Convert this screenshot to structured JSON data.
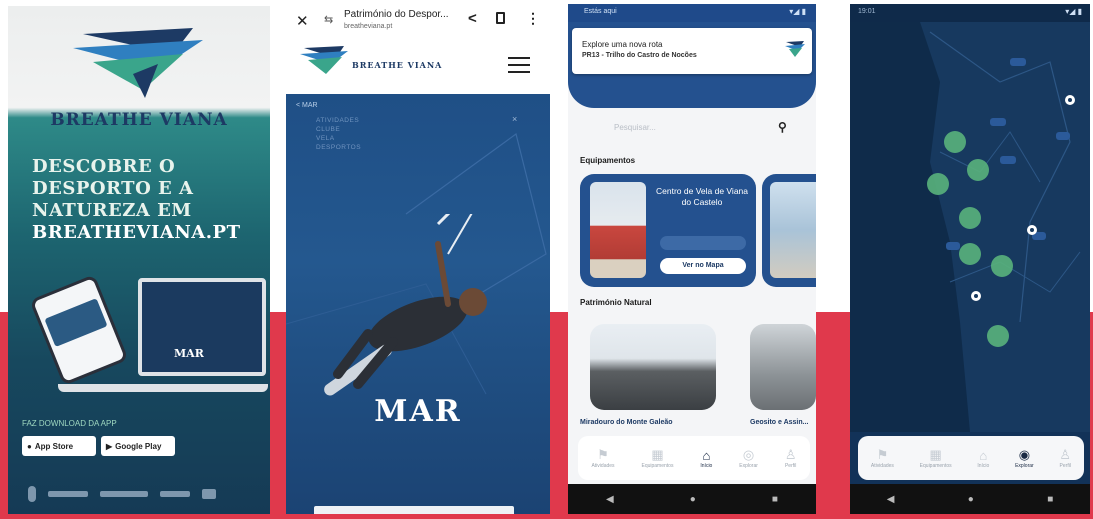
{
  "poster": {
    "brand": "BREATHE VIANA",
    "headline": [
      "DESCOBRE O",
      "DESPORTO E A",
      "NATUREZA EM",
      "BREATHEVIANA.PT"
    ],
    "tagline": "",
    "laptop_label": "MAR",
    "download_text": "FAZ DOWNLOAD DA APP",
    "app_store": "App Store",
    "google_play": "Google Play",
    "colors": {
      "brand_navy": "#1d3a64",
      "teal": "#2e8a88",
      "accent_red": "#e0394c"
    }
  },
  "website": {
    "tab_title": "Património do Despor...",
    "url": "breatheviana.pt",
    "close_icon": "✕",
    "share_icon": "<",
    "more_icon": "⋮",
    "brand": "BREATHE VIANA",
    "back": "< MAR",
    "menu_lines": [
      "ATIVIDADES",
      "CLUBE",
      "VELA",
      "DESPORTOS"
    ],
    "close_menu": "×",
    "hero_title": "MAR"
  },
  "app_home": {
    "status_left": "Estás aqui",
    "status_right": "▾◢ ▮",
    "notification": {
      "title": "Explore uma nova rota",
      "subtitle": "PR13 - Trilho do Castro de Nocões"
    },
    "search_placeholder": "Pesquisar...",
    "section_equipment": "Equipamentos",
    "equipment_card": {
      "title": "Centro de Vela de Viana do Castelo",
      "button": "Ver no Mapa"
    },
    "section_nature": "Património Natural",
    "nature_captions": [
      "Miradouro do Monte Galeão",
      "Geosito e Assin..."
    ],
    "nav": [
      {
        "icon": "⚑",
        "label": "Atividades"
      },
      {
        "icon": "▦",
        "label": "Equipamentos"
      },
      {
        "icon": "⌂",
        "label": "Início"
      },
      {
        "icon": "◎",
        "label": "Explorar"
      },
      {
        "icon": "♙",
        "label": "Perfil"
      }
    ],
    "nav_active_index": 2,
    "system_nav": [
      "◀",
      "●",
      "■"
    ]
  },
  "app_map": {
    "status_left": "19:01",
    "status_right": "▾◢ ▮",
    "nav": [
      {
        "icon": "⚑",
        "label": "Atividades"
      },
      {
        "icon": "▦",
        "label": "Equipamentos"
      },
      {
        "icon": "⌂",
        "label": "Início"
      },
      {
        "icon": "◉",
        "label": "Explorar"
      },
      {
        "icon": "♙",
        "label": "Perfil"
      }
    ],
    "nav_active_index": 3,
    "system_nav": [
      "◀",
      "●",
      "■"
    ]
  }
}
